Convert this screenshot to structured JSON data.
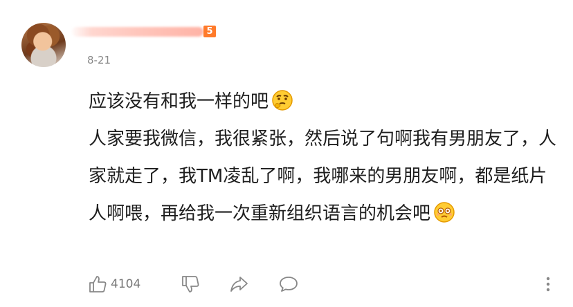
{
  "comment": {
    "level_badge": "5",
    "date": "8-21",
    "line1": "应该没有和我一样的吧",
    "emoji1": "thinking-face-emoji",
    "line2": "人家要我微信，我很紧张，然后说了句啊我有男朋友了，人家就走了，我TM凌乱了啊，我哪来的男朋友啊，都是纸片人啊喂，再给我一次重新组织语言的机会吧",
    "emoji2": "dizzy-face-emoji"
  },
  "actions": {
    "like_count": "4104",
    "icons": [
      "thumbs-up-icon",
      "thumbs-down-icon",
      "share-icon",
      "comment-icon",
      "more-icon"
    ]
  },
  "colors": {
    "badge": "#ff7a2a",
    "date": "#8a8a8a",
    "icon": "#888888",
    "text": "#1e1e1e"
  }
}
